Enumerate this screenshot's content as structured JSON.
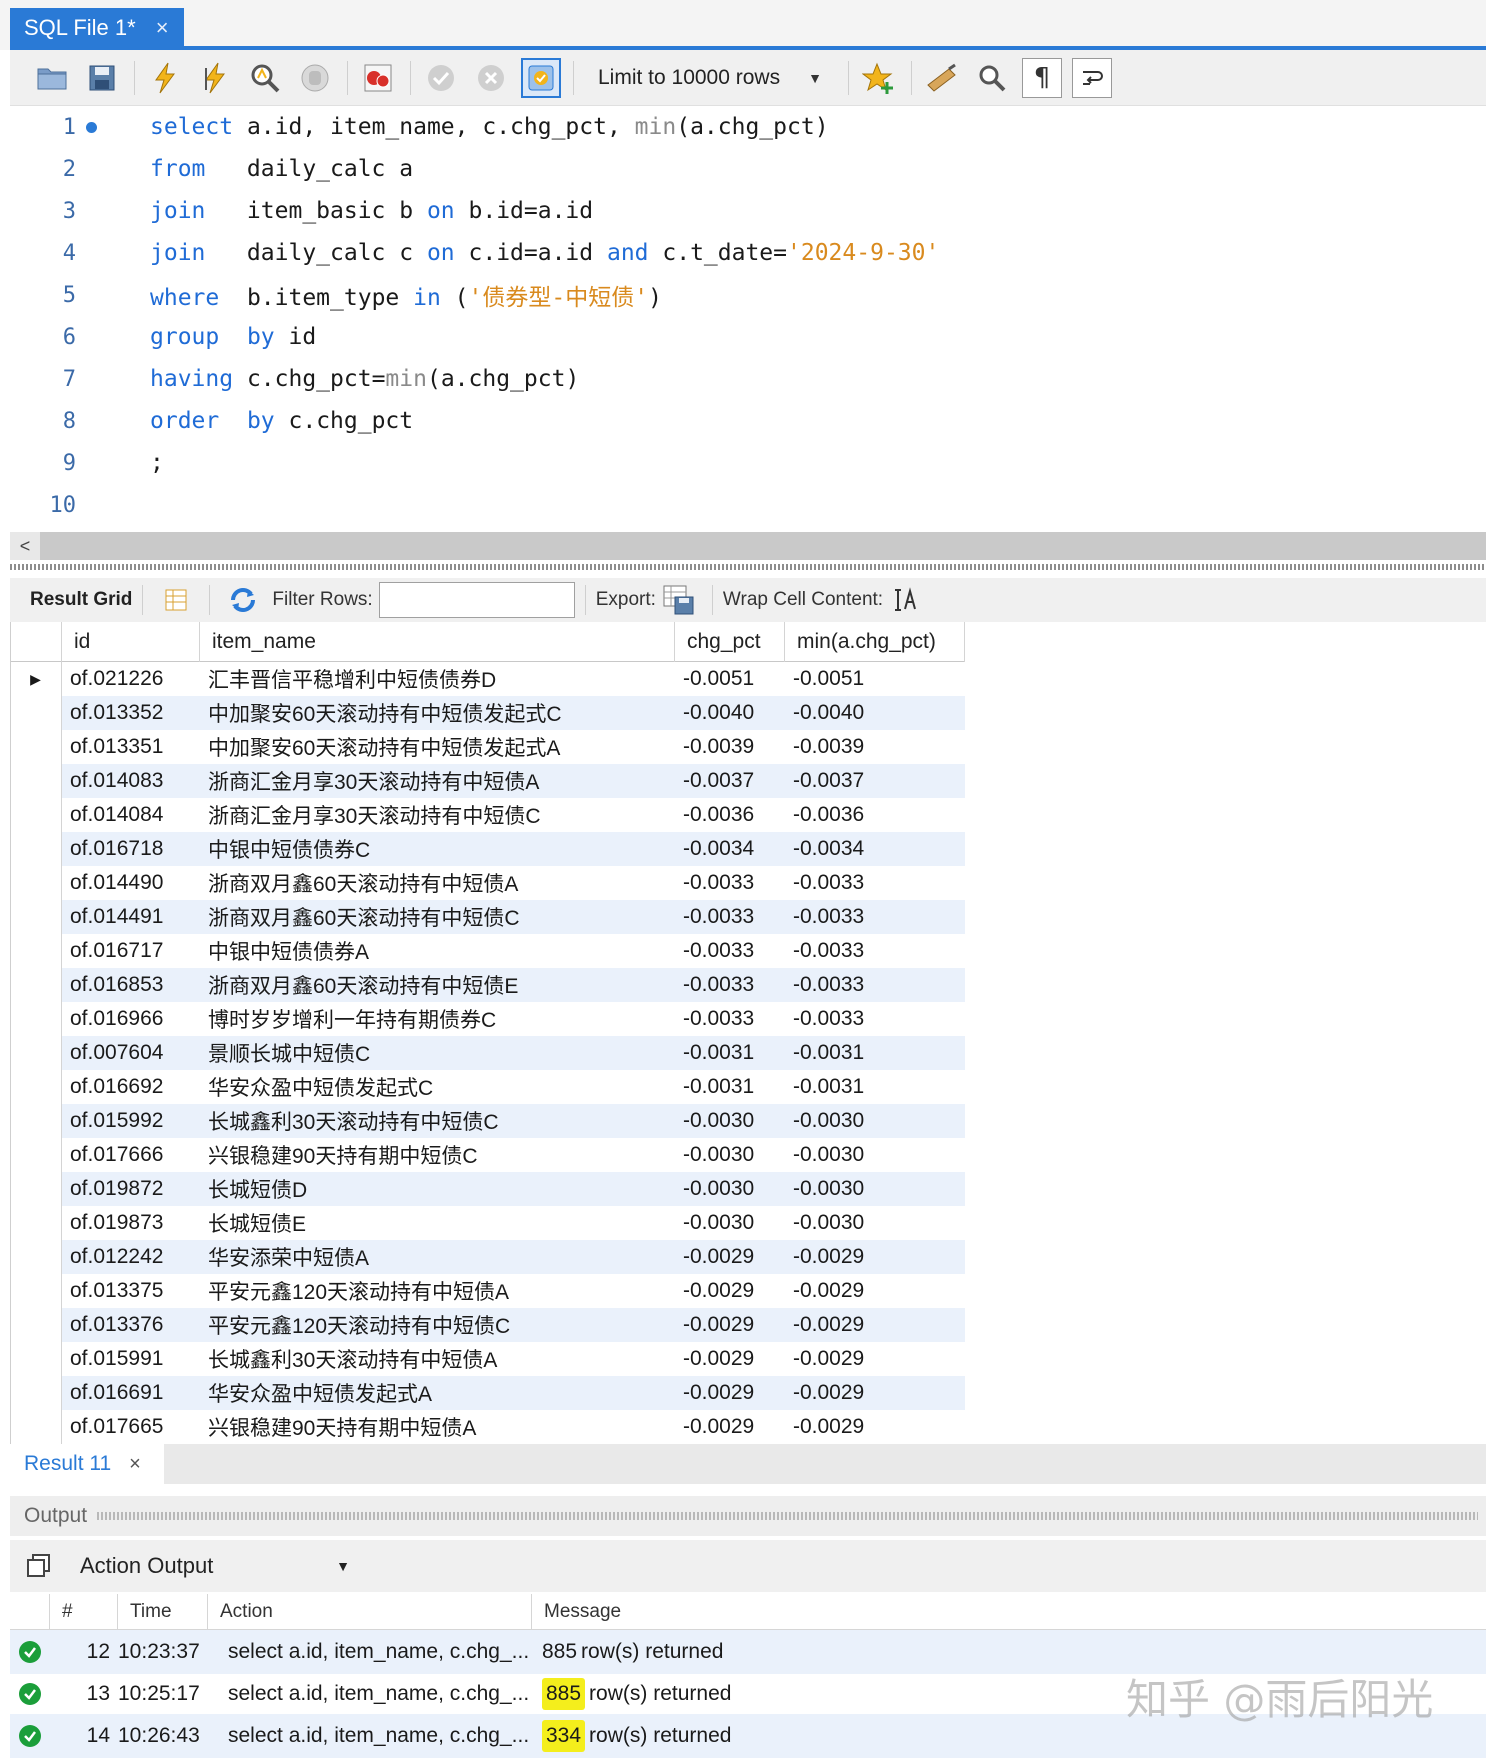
{
  "tab": {
    "title": "SQL File 1*",
    "close": "×"
  },
  "toolbar": {
    "limit_label": "Limit to 10000 rows",
    "icons": [
      "open-folder-icon",
      "save-icon",
      "execute-icon",
      "execute-current-icon",
      "explain-icon",
      "stop-icon",
      "toggle-error-icon",
      "commit-icon",
      "rollback-icon",
      "autocommit-icon",
      "bookmark-icon",
      "beautify-icon",
      "find-icon",
      "invisible-chars-icon",
      "wrap-icon"
    ]
  },
  "editor": {
    "lines": [
      {
        "n": "1",
        "parts": [
          [
            "kw",
            "select"
          ],
          [
            "t",
            " a.id, item_name, c.chg_pct, "
          ],
          [
            "fn",
            "min"
          ],
          [
            "t",
            "(a.chg_pct)"
          ]
        ]
      },
      {
        "n": "2",
        "parts": [
          [
            "kw",
            "from"
          ],
          [
            "t",
            "   daily_calc a"
          ]
        ]
      },
      {
        "n": "3",
        "parts": [
          [
            "kw",
            "join"
          ],
          [
            "t",
            "   item_basic b "
          ],
          [
            "kw",
            "on"
          ],
          [
            "t",
            " b.id=a.id"
          ]
        ]
      },
      {
        "n": "4",
        "parts": [
          [
            "kw",
            "join"
          ],
          [
            "t",
            "   daily_calc c "
          ],
          [
            "kw",
            "on"
          ],
          [
            "t",
            " c.id=a.id "
          ],
          [
            "kw",
            "and"
          ],
          [
            "t",
            " c.t_date="
          ],
          [
            "str",
            "'2024-9-30'"
          ]
        ]
      },
      {
        "n": "5",
        "parts": [
          [
            "kw",
            "where"
          ],
          [
            "t",
            "  b.item_type "
          ],
          [
            "kw",
            "in"
          ],
          [
            "t",
            " ("
          ],
          [
            "str",
            "'债券型-中短债'"
          ],
          [
            "t",
            ")"
          ]
        ]
      },
      {
        "n": "6",
        "parts": [
          [
            "kw",
            "group"
          ],
          [
            "t",
            "  "
          ],
          [
            "kw",
            "by"
          ],
          [
            "t",
            " id"
          ]
        ]
      },
      {
        "n": "7",
        "parts": [
          [
            "kw",
            "having"
          ],
          [
            "t",
            " c.chg_pct="
          ],
          [
            "fn",
            "min"
          ],
          [
            "t",
            "(a.chg_pct)"
          ]
        ]
      },
      {
        "n": "8",
        "parts": [
          [
            "kw",
            "order"
          ],
          [
            "t",
            "  "
          ],
          [
            "kw",
            "by"
          ],
          [
            "t",
            " c.chg_pct"
          ]
        ]
      },
      {
        "n": "9",
        "parts": [
          [
            "t",
            ";"
          ]
        ]
      },
      {
        "n": "10",
        "parts": []
      }
    ]
  },
  "result_toolbar": {
    "result_grid": "Result Grid",
    "filter_rows": "Filter Rows:",
    "export": "Export:",
    "wrap": "Wrap Cell Content:"
  },
  "grid": {
    "columns": [
      "id",
      "item_name",
      "chg_pct",
      "min(a.chg_pct)"
    ],
    "rows": [
      [
        "of.021226",
        "汇丰晋信平稳增利中短债债券D",
        "-0.0051",
        "-0.0051"
      ],
      [
        "of.013352",
        "中加聚安60天滚动持有中短债发起式C",
        "-0.0040",
        "-0.0040"
      ],
      [
        "of.013351",
        "中加聚安60天滚动持有中短债发起式A",
        "-0.0039",
        "-0.0039"
      ],
      [
        "of.014083",
        "浙商汇金月享30天滚动持有中短债A",
        "-0.0037",
        "-0.0037"
      ],
      [
        "of.014084",
        "浙商汇金月享30天滚动持有中短债C",
        "-0.0036",
        "-0.0036"
      ],
      [
        "of.016718",
        "中银中短债债券C",
        "-0.0034",
        "-0.0034"
      ],
      [
        "of.014490",
        "浙商双月鑫60天滚动持有中短债A",
        "-0.0033",
        "-0.0033"
      ],
      [
        "of.014491",
        "浙商双月鑫60天滚动持有中短债C",
        "-0.0033",
        "-0.0033"
      ],
      [
        "of.016717",
        "中银中短债债券A",
        "-0.0033",
        "-0.0033"
      ],
      [
        "of.016853",
        "浙商双月鑫60天滚动持有中短债E",
        "-0.0033",
        "-0.0033"
      ],
      [
        "of.016966",
        "博时岁岁增利一年持有期债券C",
        "-0.0033",
        "-0.0033"
      ],
      [
        "of.007604",
        "景顺长城中短债C",
        "-0.0031",
        "-0.0031"
      ],
      [
        "of.016692",
        "华安众盈中短债发起式C",
        "-0.0031",
        "-0.0031"
      ],
      [
        "of.015992",
        "长城鑫利30天滚动持有中短债C",
        "-0.0030",
        "-0.0030"
      ],
      [
        "of.017666",
        "兴银稳建90天持有期中短债C",
        "-0.0030",
        "-0.0030"
      ],
      [
        "of.019872",
        "长城短债D",
        "-0.0030",
        "-0.0030"
      ],
      [
        "of.019873",
        "长城短债E",
        "-0.0030",
        "-0.0030"
      ],
      [
        "of.012242",
        "华安添荣中短债A",
        "-0.0029",
        "-0.0029"
      ],
      [
        "of.013375",
        "平安元鑫120天滚动持有中短债A",
        "-0.0029",
        "-0.0029"
      ],
      [
        "of.013376",
        "平安元鑫120天滚动持有中短债C",
        "-0.0029",
        "-0.0029"
      ],
      [
        "of.015991",
        "长城鑫利30天滚动持有中短债A",
        "-0.0029",
        "-0.0029"
      ],
      [
        "of.016691",
        "华安众盈中短债发起式A",
        "-0.0029",
        "-0.0029"
      ],
      [
        "of.017665",
        "兴银稳建90天持有期中短债A",
        "-0.0029",
        "-0.0029"
      ]
    ]
  },
  "result_tab": {
    "label": "Result 11",
    "close": "×"
  },
  "output": {
    "title": "Output",
    "selector": "Action Output",
    "columns": [
      "#",
      "Time",
      "Action",
      "Message"
    ],
    "rows": [
      {
        "num": "12",
        "time": "10:23:37",
        "action": "select a.id, item_name, c.chg_...",
        "count": "885",
        "msg": "row(s) returned",
        "highlight": false
      },
      {
        "num": "13",
        "time": "10:25:17",
        "action": "select a.id, item_name, c.chg_...",
        "count": "885",
        "msg": "row(s) returned",
        "highlight": true
      },
      {
        "num": "14",
        "time": "10:26:43",
        "action": "select a.id, item_name, c.chg_...",
        "count": "334",
        "msg": "row(s) returned",
        "highlight": true
      }
    ]
  },
  "watermark": "知乎 @雨后阳光",
  "colors": {
    "accent": "#2a7ad6",
    "keyword": "#1f6bd6",
    "string": "#d98a1e",
    "row_alt": "#eaf1fb",
    "highlight": "#f4ee1c",
    "success": "#1b9e3a"
  }
}
